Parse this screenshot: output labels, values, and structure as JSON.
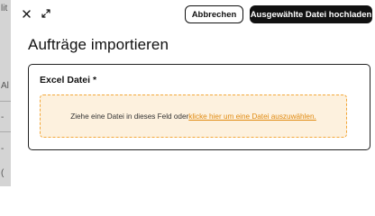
{
  "background": {
    "fragments": [
      "lit",
      "Al",
      "-",
      "-",
      "("
    ]
  },
  "topbar": {
    "close_icon": "close-icon",
    "expand_icon": "expand-icon",
    "cancel_label": "Abbrechen",
    "upload_label": "Ausgewählte Datei hochladen"
  },
  "page": {
    "title": "Aufträge importieren"
  },
  "form": {
    "field_label": "Excel Datei *",
    "dropzone_text": "Ziehe eine Datei in dieses Feld oder ",
    "dropzone_link": "klicke hier um eine Datei auszuwählen."
  },
  "colors": {
    "accent": "#f3a83a",
    "dropzone_bg": "#fdf1de",
    "link": "#e08a10",
    "primary": "#111111"
  }
}
